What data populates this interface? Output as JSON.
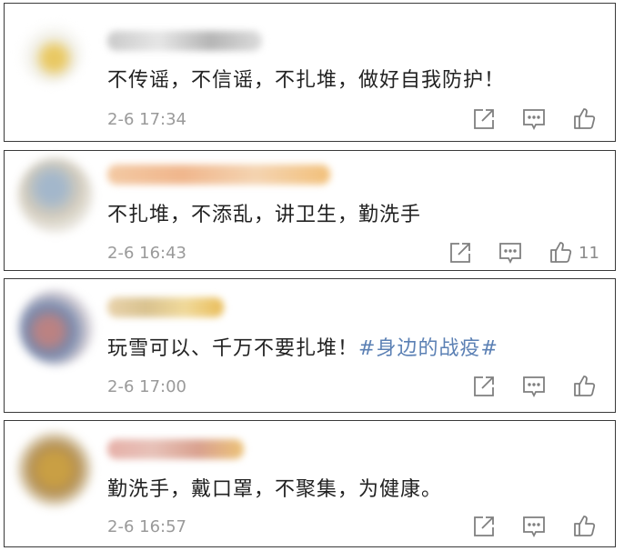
{
  "comments": [
    {
      "text": "不传谣，不信谣，不扎堆，做好自我防护！",
      "hashtag": "",
      "time": "2-6 17:34",
      "likes": ""
    },
    {
      "text": "不扎堆，不添乱，讲卫生，勤洗手",
      "hashtag": "",
      "time": "2-6 16:43",
      "likes": "11"
    },
    {
      "text": "玩雪可以、千万不要扎堆！",
      "hashtag": "#身边的战疫#",
      "time": "2-6 17:00",
      "likes": ""
    },
    {
      "text": "勤洗手，戴口罩，不聚集，为健康。",
      "hashtag": "",
      "time": "2-6 16:57",
      "likes": ""
    }
  ],
  "colors": {
    "text": "#222222",
    "time": "#9a9a9a",
    "hashtag": "#5b80b4",
    "icon": "#7f7f7f",
    "border": "#3a3a3a"
  }
}
